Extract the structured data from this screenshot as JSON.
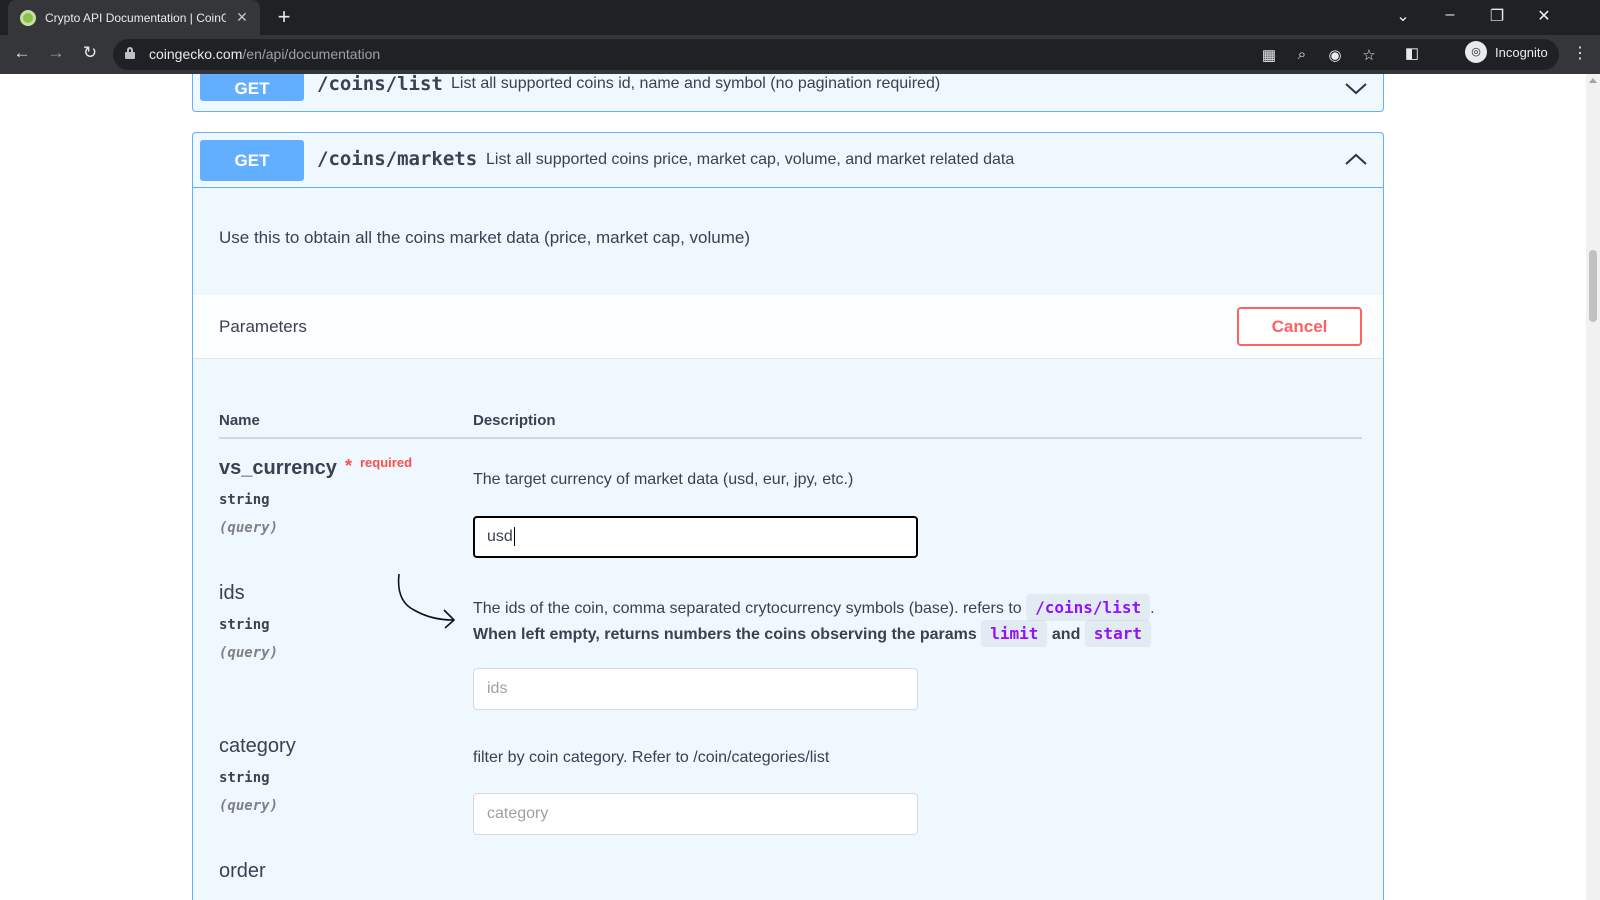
{
  "browser": {
    "tab_title": "Crypto API Documentation | CoinGe",
    "new_tab": "+",
    "url_host": "coingecko.com",
    "url_path": "/en/api/documentation",
    "profile_label": "Incognito"
  },
  "endpoints": [
    {
      "method": "GET",
      "path": "/coins/list",
      "summary": "List all supported coins id, name and symbol (no pagination required)",
      "expanded": false
    },
    {
      "method": "GET",
      "path": "/coins/markets",
      "summary": "List all supported coins price, market cap, volume, and market related data",
      "expanded": true,
      "description": "Use this to obtain all the coins market data (price, market cap, volume)",
      "parameters_title": "Parameters",
      "cancel_label": "Cancel",
      "columns": {
        "name": "Name",
        "description": "Description"
      },
      "params": [
        {
          "name": "vs_currency",
          "required_star": "*",
          "required_label": "required",
          "type": "string",
          "in": "(query)",
          "description": "The target currency of market data (usd, eur, jpy, etc.)",
          "value": "usd"
        },
        {
          "name": "ids",
          "type": "string",
          "in": "(query)",
          "description": "The ids of the coin, comma separated crytocurrency symbols (base). refers to",
          "description_code": "/coins/list",
          "description_end": ".",
          "note": "When left empty, returns numbers the coins observing the params",
          "note_code_1": "limit",
          "note_and": "and",
          "note_code_2": "start",
          "placeholder": "ids"
        },
        {
          "name": "category",
          "type": "string",
          "in": "(query)",
          "description": "filter by coin category. Refer to /coin/categories/list",
          "placeholder": "category"
        },
        {
          "name": "order"
        }
      ]
    }
  ]
}
